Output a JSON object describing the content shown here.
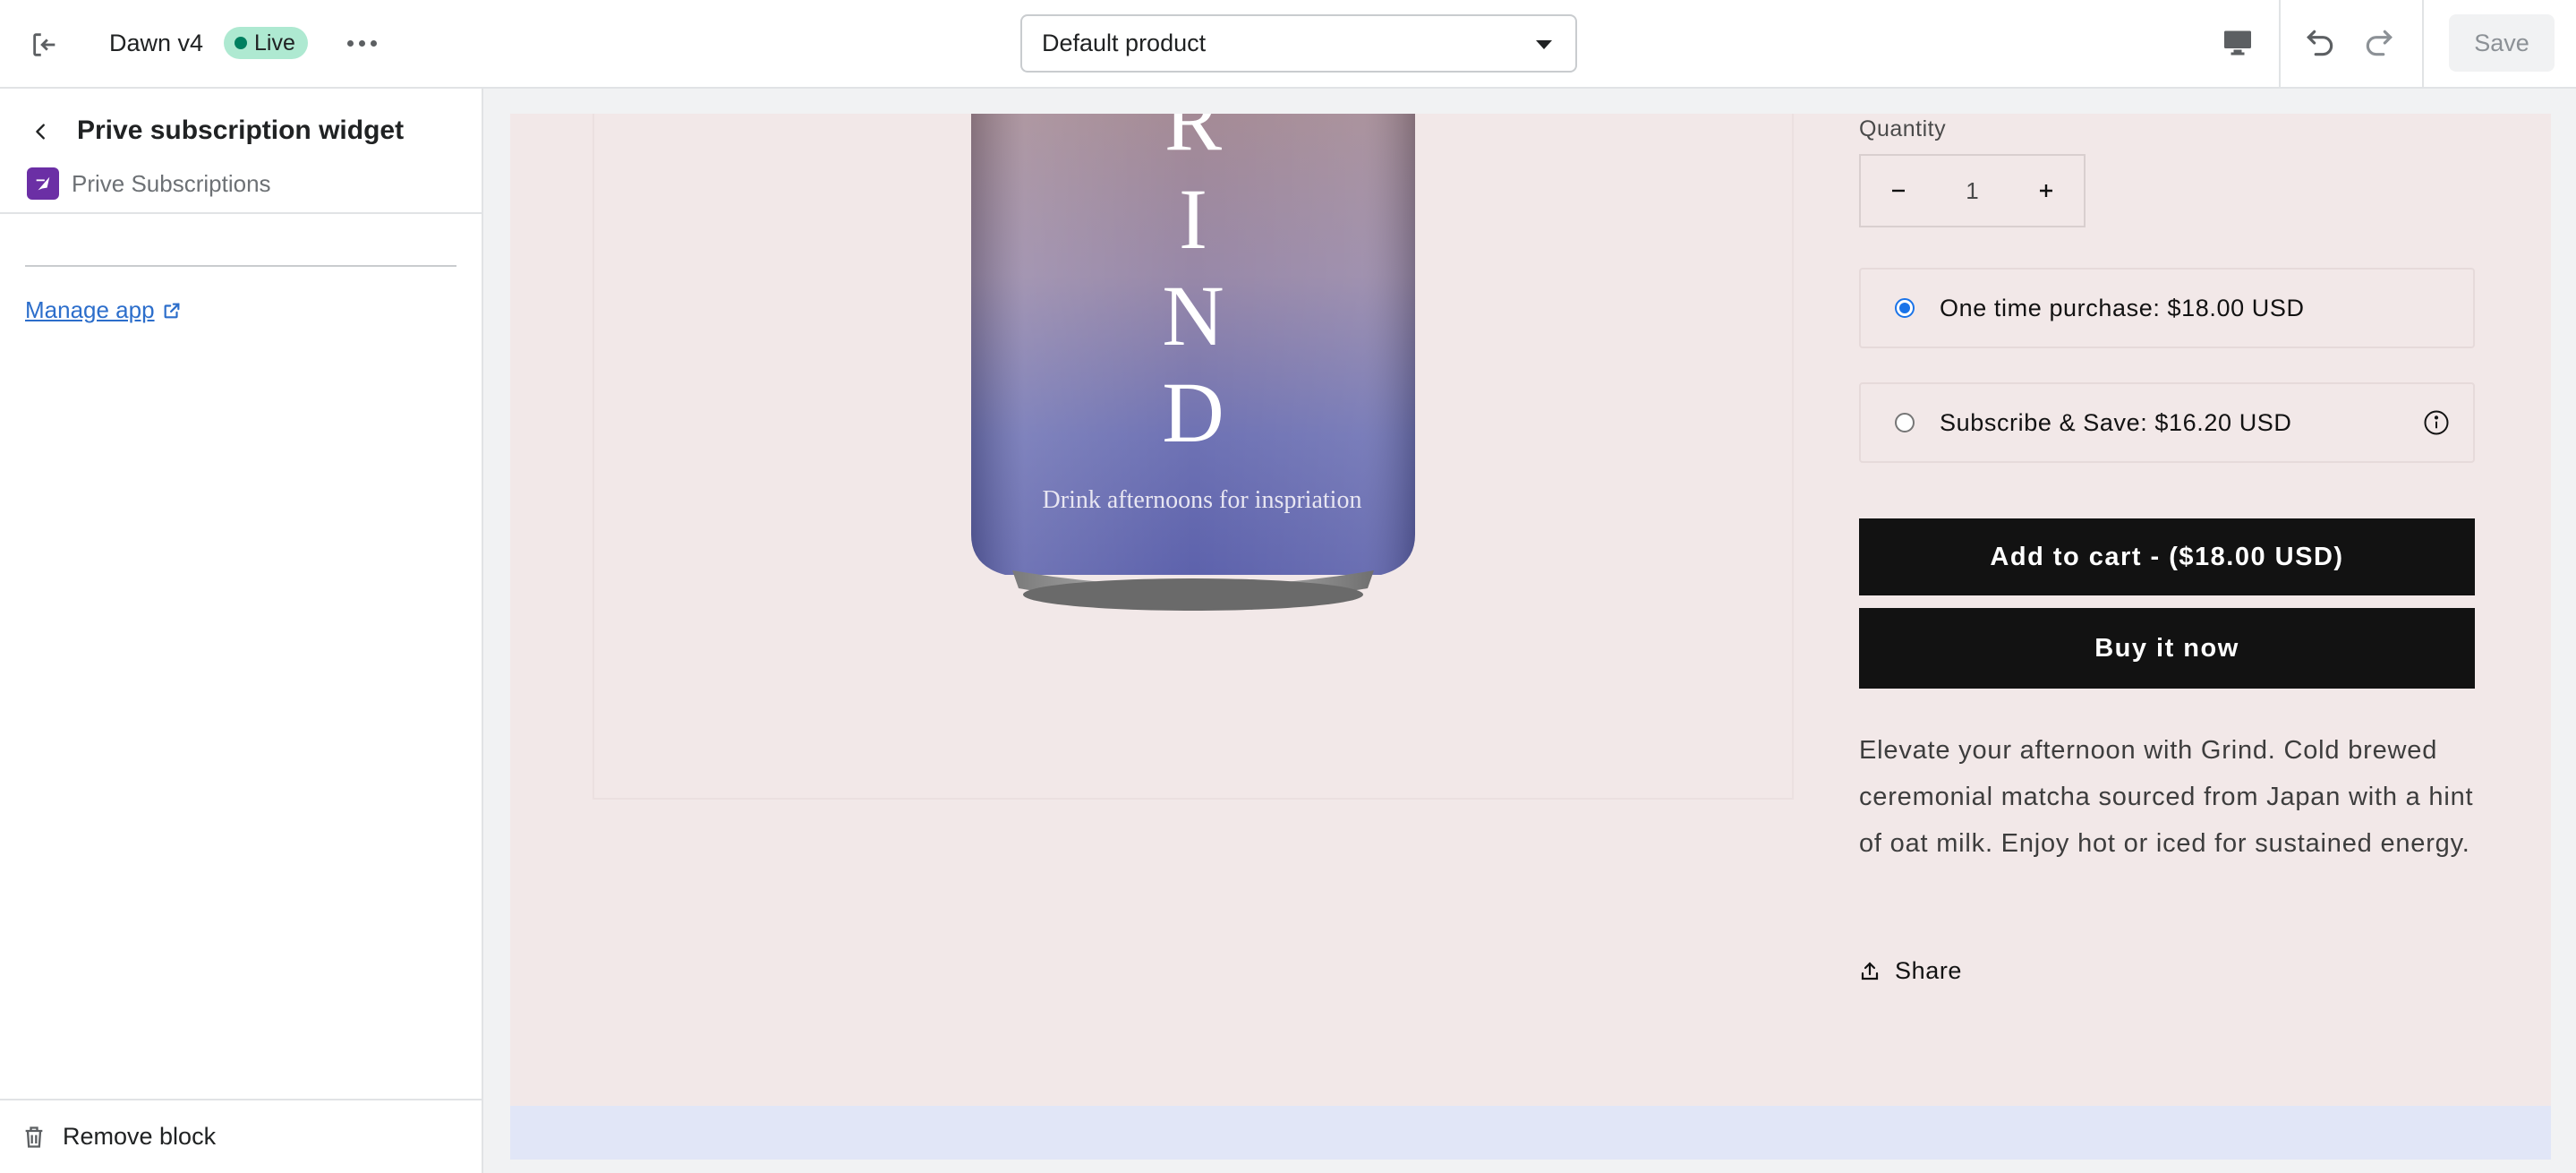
{
  "topbar": {
    "theme_name": "Dawn v4",
    "live_badge": "Live",
    "product_selector": "Default product",
    "save_label": "Save",
    "icons": [
      "exit-icon",
      "more-icon",
      "desktop-icon",
      "undo-icon",
      "redo-icon"
    ]
  },
  "sidebar": {
    "block_title": "Prive subscription widget",
    "app_name": "Prive Subscriptions",
    "manage_link": "Manage app",
    "remove_label": "Remove block"
  },
  "preview": {
    "can_letters": [
      "R",
      "I",
      "N",
      "D"
    ],
    "can_tagline": "Drink afternoons for inspriation",
    "quantity_label": "Quantity",
    "quantity_value": "1",
    "option_one_time": "One time purchase: $18.00 USD",
    "option_subscribe": "Subscribe & Save: $16.20 USD",
    "selected_option": "one_time",
    "add_to_cart": "Add to cart - ($18.00 USD)",
    "buy_now": "Buy it now",
    "description": "Elevate your afternoon with Grind. Cold brewed ceremonial matcha sourced from Japan with a hint of oat milk. Enjoy hot or iced for sustained energy.",
    "share_label": "Share"
  },
  "colors": {
    "live_badge_bg": "#aee9d1",
    "preview_bg": "#f2e8e8",
    "button_black": "#121212",
    "link_blue": "#2c6ecb",
    "app_logo": "#6b2fa5"
  }
}
